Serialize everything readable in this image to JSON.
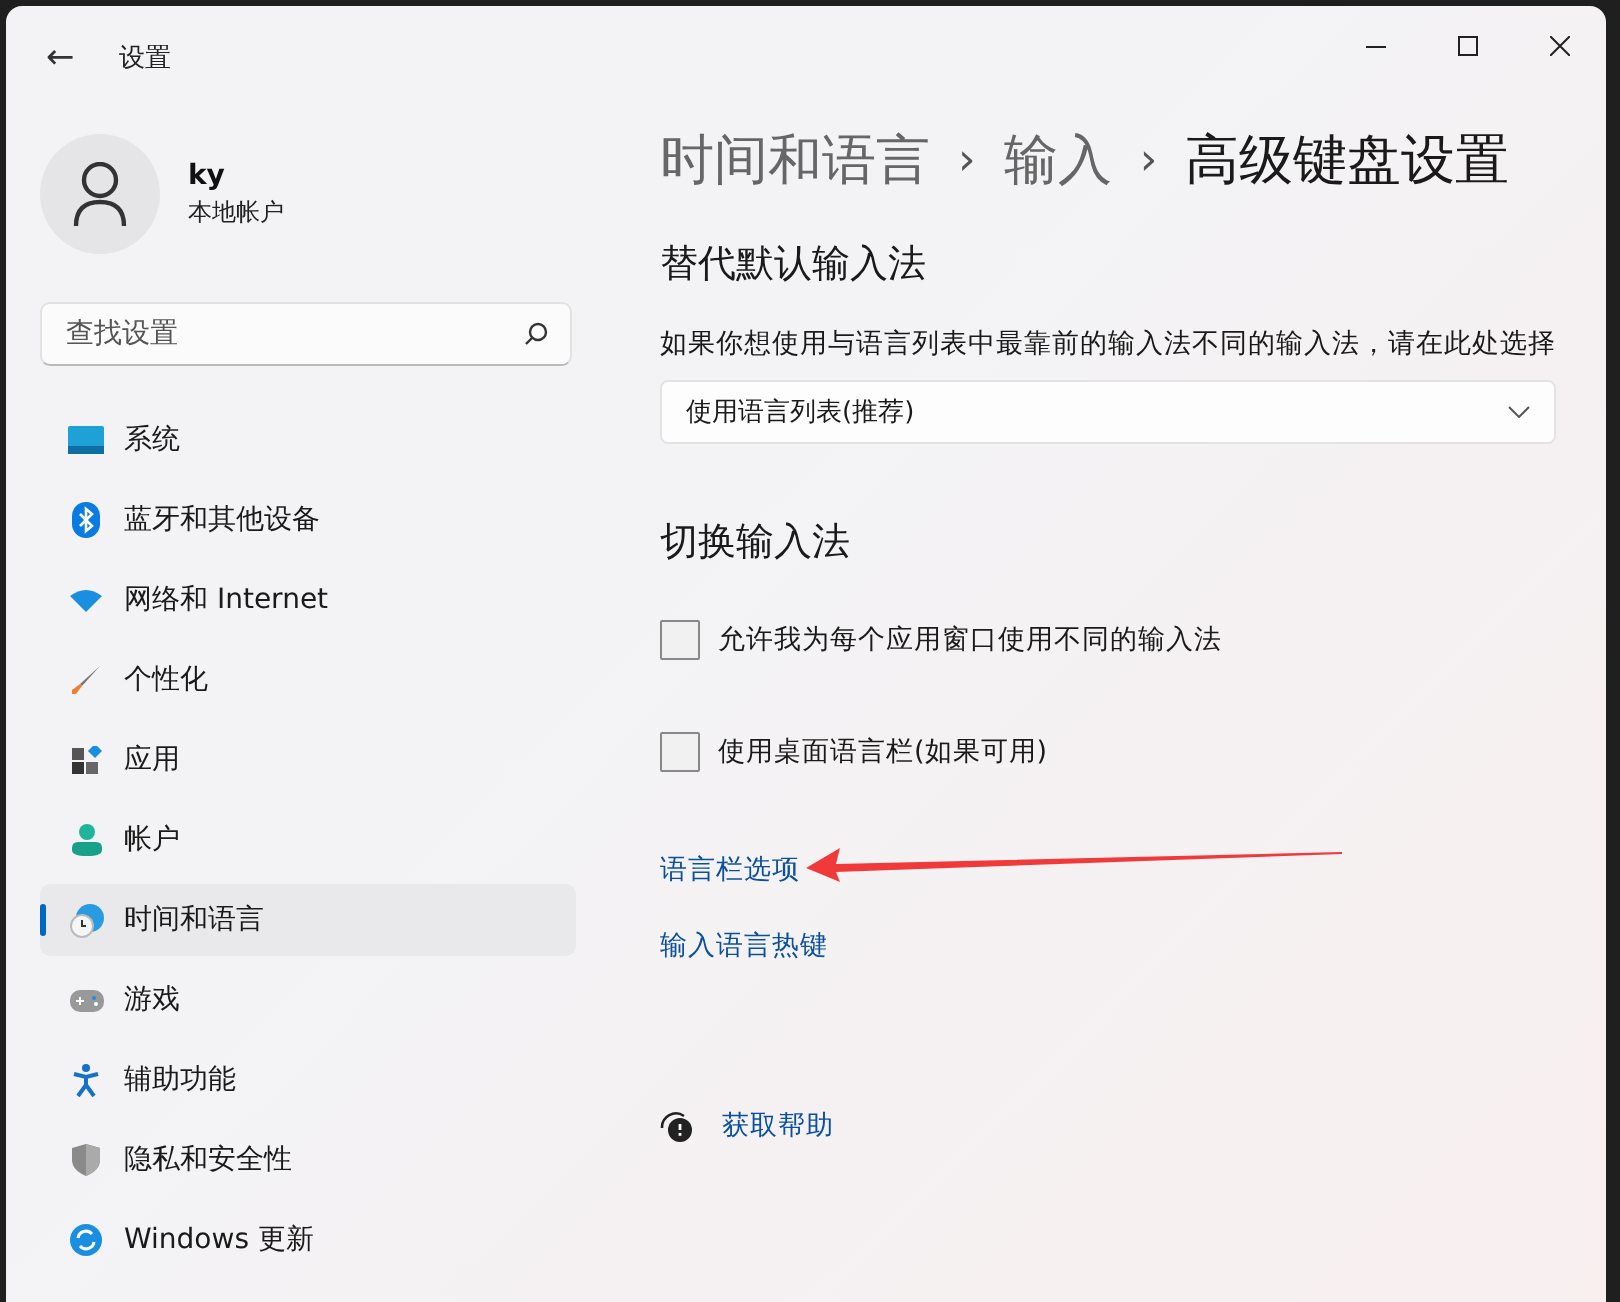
{
  "window": {
    "title": "设置",
    "back": "←"
  },
  "account": {
    "name": "ky",
    "type": "本地帐户"
  },
  "search": {
    "placeholder": "查找设置"
  },
  "sidebar": {
    "items": [
      {
        "label": "系统",
        "selected": false
      },
      {
        "label": "蓝牙和其他设备",
        "selected": false
      },
      {
        "label": "网络和 Internet",
        "selected": false
      },
      {
        "label": "个性化",
        "selected": false
      },
      {
        "label": "应用",
        "selected": false
      },
      {
        "label": "帐户",
        "selected": false
      },
      {
        "label": "时间和语言",
        "selected": true
      },
      {
        "label": "游戏",
        "selected": false
      },
      {
        "label": "辅助功能",
        "selected": false
      },
      {
        "label": "隐私和安全性",
        "selected": false
      },
      {
        "label": "Windows 更新",
        "selected": false
      }
    ]
  },
  "breadcrumb": [
    {
      "label": "时间和语言",
      "current": false
    },
    {
      "label": "输入",
      "current": false
    },
    {
      "label": "高级键盘设置",
      "current": true
    }
  ],
  "breadcrumb_separator": "›",
  "sections": [
    {
      "title": "替代默认输入法",
      "description": "如果你想使用与语言列表中最靠前的输入法不同的输入法，请在此处选择",
      "dropdown": {
        "value": "使用语言列表(推荐)"
      }
    },
    {
      "title": "切换输入法",
      "checkboxes": [
        {
          "label": "允许我为每个应用窗口使用不同的输入法",
          "checked": false
        },
        {
          "label": "使用桌面语言栏(如果可用)",
          "checked": false
        }
      ],
      "links": [
        "语言栏选项",
        "输入语言热键"
      ]
    }
  ],
  "help": {
    "label": "获取帮助"
  }
}
